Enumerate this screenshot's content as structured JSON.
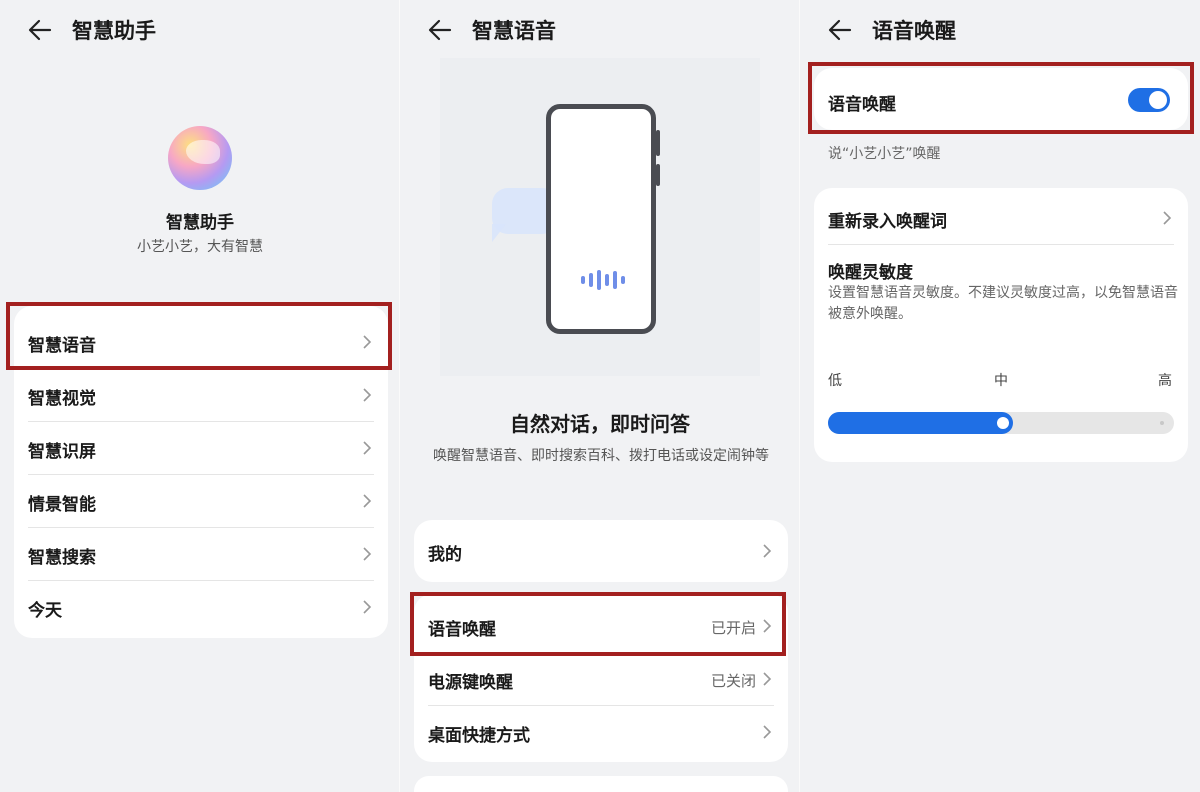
{
  "colors": {
    "background": "#f1f2f4",
    "accent": "#1f6fe5",
    "highlight": "#a3201f"
  },
  "icons": {
    "back": "arrow-left-icon",
    "chevron": "chevron-right-icon"
  },
  "panel1": {
    "title": "智慧助手",
    "app_name": "智慧助手",
    "app_subtitle": "小艺小艺，大有智慧",
    "items": [
      {
        "label": "智慧语音"
      },
      {
        "label": "智慧视觉"
      },
      {
        "label": "智慧识屏"
      },
      {
        "label": "情景智能"
      },
      {
        "label": "智慧搜索"
      },
      {
        "label": "今天"
      }
    ]
  },
  "panel2": {
    "title": "智慧语音",
    "headline": "自然对话，即时问答",
    "description": "唤醒智慧语音、即时搜索百科、拨打电话或设定闹钟等",
    "items": [
      {
        "label": "我的",
        "value": ""
      },
      {
        "label": "语音唤醒",
        "value": "已开启"
      },
      {
        "label": "电源键唤醒",
        "value": "已关闭"
      },
      {
        "label": "桌面快捷方式",
        "value": ""
      }
    ]
  },
  "panel3": {
    "title": "语音唤醒",
    "toggle_label": "语音唤醒",
    "toggle_on": true,
    "hint": "说“小艺小艺”唤醒",
    "rerecord_label": "重新录入唤醒词",
    "sensitivity_title": "唤醒灵敏度",
    "sensitivity_desc": "设置智慧语音灵敏度。不建议灵敏度过高，以免智慧语音被意外唤醒。",
    "ticks": {
      "low": "低",
      "mid": "中",
      "high": "高"
    },
    "sensitivity_level": 0.5
  }
}
